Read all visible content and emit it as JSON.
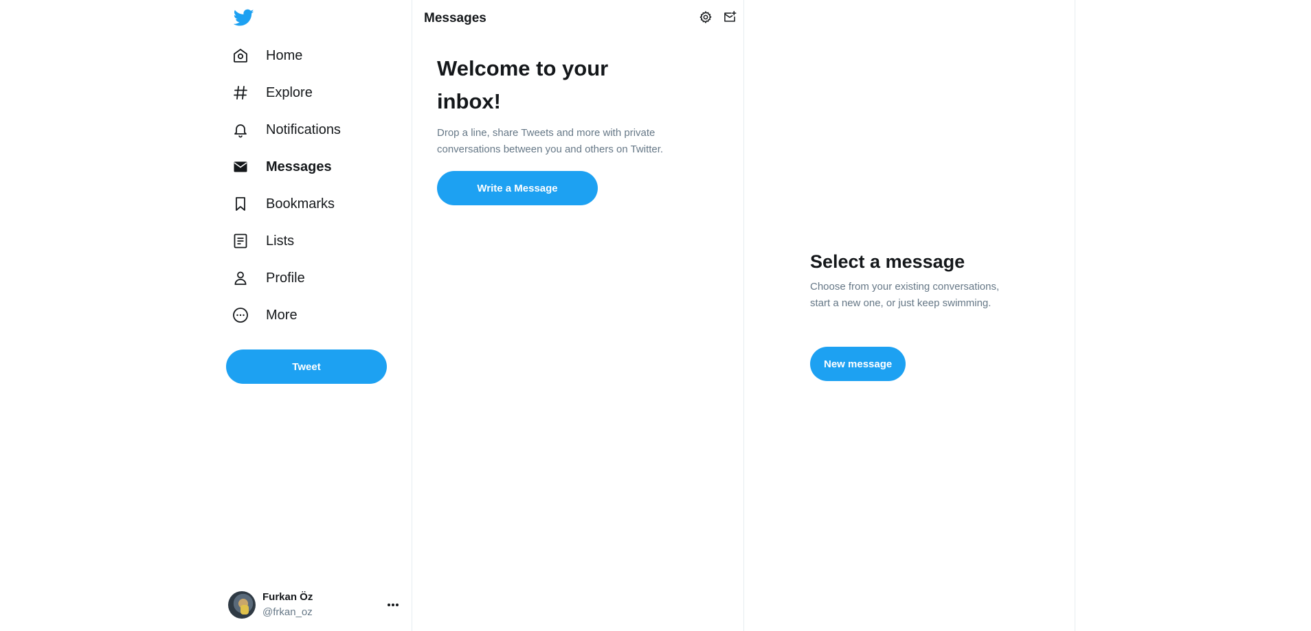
{
  "app": {
    "brand_icon": "twitter-bird-icon",
    "accent_color": "#1da1f2"
  },
  "sidebar": {
    "items": [
      {
        "label": "Home",
        "icon": "home-icon"
      },
      {
        "label": "Explore",
        "icon": "hashtag-icon"
      },
      {
        "label": "Notifications",
        "icon": "bell-icon"
      },
      {
        "label": "Messages",
        "icon": "envelope-icon",
        "active": true
      },
      {
        "label": "Bookmarks",
        "icon": "bookmark-icon"
      },
      {
        "label": "Lists",
        "icon": "list-icon"
      },
      {
        "label": "Profile",
        "icon": "person-icon"
      },
      {
        "label": "More",
        "icon": "more-circle-icon"
      }
    ],
    "tweet_label": "Tweet",
    "account": {
      "name": "Furkan Öz",
      "handle": "@frkan_oz"
    }
  },
  "messages": {
    "title": "Messages",
    "welcome_title": "Welcome to your inbox!",
    "welcome_text": "Drop a line, share Tweets and more with private conversations between you and others on Twitter.",
    "write_label": "Write a Message"
  },
  "detail": {
    "title": "Select a message",
    "text": "Choose from your existing conversations, start a new one, or just keep swimming.",
    "new_label": "New message"
  }
}
